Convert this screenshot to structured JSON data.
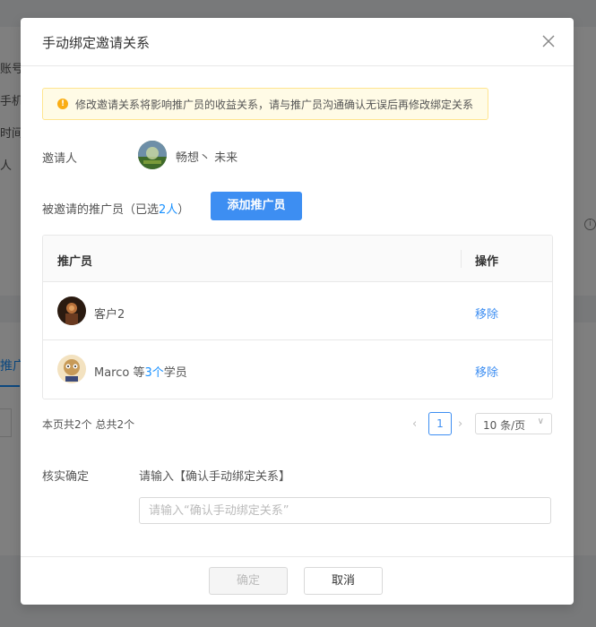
{
  "background": {
    "labels": [
      "账号",
      "手机",
      "时间",
      "人"
    ],
    "tab": "推广",
    "info_icon": "i"
  },
  "modal": {
    "title": "手动绑定邀请关系",
    "close_icon": "close-icon"
  },
  "alert": {
    "icon": "!",
    "text": "修改邀请关系将影响推广员的收益关系，请与推广员沟通确认无误后再修改绑定关系"
  },
  "inviter": {
    "label": "邀请人",
    "name": "畅想丶 未来"
  },
  "invited": {
    "label_prefix": "被邀请的推广员（已选",
    "count": "2人",
    "label_suffix": "）",
    "add_button": "添加推广员"
  },
  "table": {
    "columns": [
      "推广员",
      "操作"
    ],
    "rows": [
      {
        "name": "客户2",
        "name_suffix_highlight": "",
        "name_tail": "",
        "action": "移除"
      },
      {
        "name": "Marco 等",
        "name_suffix_highlight": "3个",
        "name_tail": "学员",
        "action": "移除"
      }
    ]
  },
  "pagination": {
    "summary": "本页共2个 总共2个",
    "prev": "‹",
    "current_page": "1",
    "next": "›",
    "page_size": "10 条/页",
    "page_size_chevron": "∨"
  },
  "confirm": {
    "label": "核实确定",
    "hint": "请输入【确认手动绑定关系】",
    "placeholder": "请输入“确认手动绑定关系”",
    "value": ""
  },
  "footer": {
    "ok": "确定",
    "cancel": "取消"
  },
  "colors": {
    "primary": "#3d8ef2",
    "warning": "#faad14",
    "alert_bg": "#fffbe6"
  }
}
